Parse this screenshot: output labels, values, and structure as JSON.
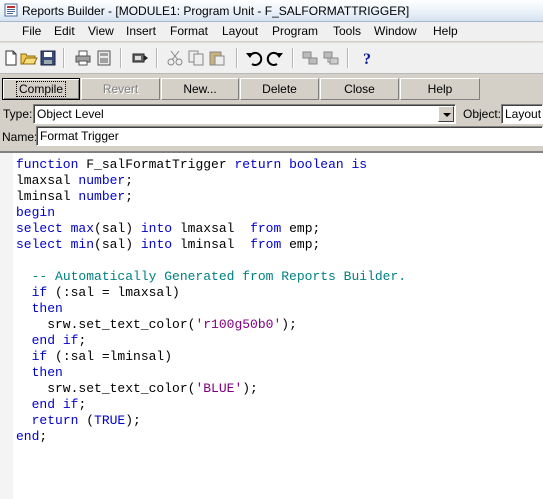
{
  "window": {
    "title": "Reports Builder - [MODULE1: Program Unit - F_SALFORMATTRIGGER]"
  },
  "menu": [
    "File",
    "Edit",
    "View",
    "Insert",
    "Format",
    "Layout",
    "Program",
    "Tools",
    "Window",
    "Help"
  ],
  "toolbar_icons": [
    "new-icon",
    "open-icon",
    "save-icon",
    "print-icon",
    "print-preview-icon",
    "run-icon",
    "cut-icon",
    "copy-icon",
    "paste-icon",
    "undo-icon",
    "redo-icon",
    "module-icon",
    "module2-icon",
    "help-icon"
  ],
  "buttons": {
    "compile": "Compile",
    "revert": "Revert",
    "new": "New...",
    "delete": "Delete",
    "close": "Close",
    "help": "Help"
  },
  "type_field": {
    "label": "Type:",
    "value": "Object Level"
  },
  "object_field": {
    "label": "Object:",
    "value": "Layout R"
  },
  "name_field": {
    "label": "Name:",
    "value": "Format Trigger"
  },
  "code_lines": [
    "function F_salFormatTrigger return boolean is",
    "lmaxsal number;",
    "lminsal number;",
    "begin",
    "select max(sal) into lmaxsal  from emp;",
    "select min(sal) into lminsal  from emp;",
    "",
    "  -- Automatically Generated from Reports Builder.",
    "  if (:sal = lmaxsal)",
    "  then",
    "    srw.set_text_color('r100g50b0');",
    "  end if;",
    "  if (:sal =lminsal)",
    "  then",
    "    srw.set_text_color('BLUE');",
    "  end if;",
    "  return (TRUE);",
    "end;"
  ],
  "colors": {
    "keyword": "#0000cc",
    "string": "#800080",
    "comment": "#008080"
  }
}
